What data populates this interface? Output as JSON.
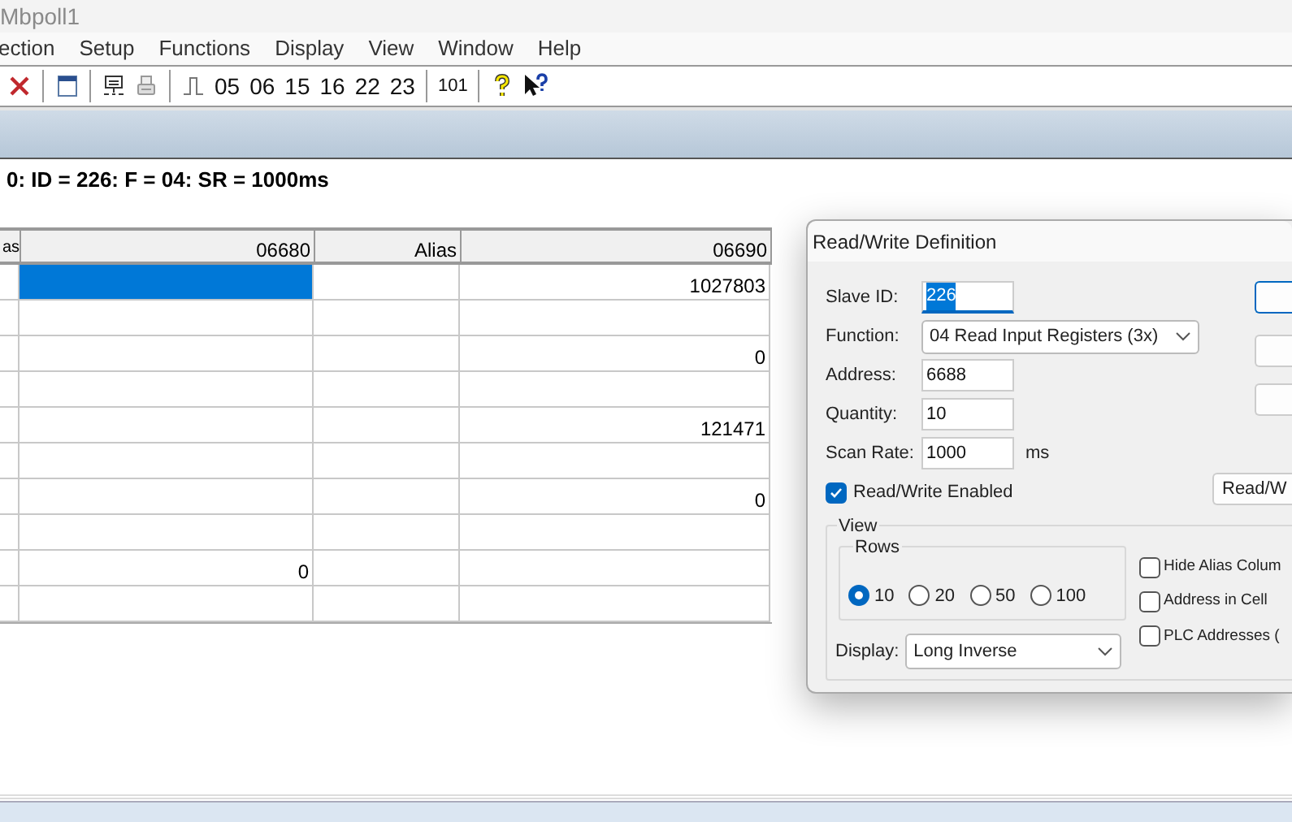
{
  "window": {
    "title": "Mbpoll1"
  },
  "menu": [
    "ection",
    "Setup",
    "Functions",
    "Display",
    "View",
    "Window",
    "Help"
  ],
  "toolbar": [
    {
      "kind": "close"
    },
    {
      "kind": "sep"
    },
    {
      "kind": "window"
    },
    {
      "kind": "sep"
    },
    {
      "kind": "monitor"
    },
    {
      "kind": "printer"
    },
    {
      "kind": "sep"
    },
    {
      "kind": "pulse"
    },
    {
      "kind": "text",
      "label": "05"
    },
    {
      "kind": "text",
      "label": "06"
    },
    {
      "kind": "text",
      "label": "15"
    },
    {
      "kind": "text",
      "label": "16"
    },
    {
      "kind": "text",
      "label": "22"
    },
    {
      "kind": "text",
      "label": "23"
    },
    {
      "kind": "sep"
    },
    {
      "kind": "small",
      "label": "101"
    },
    {
      "kind": "sep"
    },
    {
      "kind": "help"
    },
    {
      "kind": "contexthelp"
    }
  ],
  "status_line": "0: ID = 226: F = 04: SR = 1000ms",
  "table": {
    "columns": [
      "as",
      "06680",
      "Alias",
      "06690"
    ],
    "rows": [
      {
        "selected": true,
        "col_4": "1027803"
      },
      {
        "selected": false
      },
      {
        "selected": false,
        "col_4": "0"
      },
      {
        "selected": false
      },
      {
        "selected": false,
        "col_4": "121471"
      },
      {
        "selected": false
      },
      {
        "selected": false,
        "col_4": "0"
      },
      {
        "selected": false
      },
      {
        "selected": false,
        "col_2": "0"
      },
      {
        "selected": false
      }
    ]
  },
  "dialog": {
    "title": "Read/Write Definition",
    "fields": [
      {
        "kind": "input",
        "label": "Slave ID:",
        "value": "226",
        "focused": true
      },
      {
        "kind": "select",
        "label": "Function:",
        "value": "04 Read Input Registers (3x)"
      },
      {
        "kind": "input",
        "label": "Address:",
        "value": "6688",
        "focused": false
      },
      {
        "kind": "input",
        "label": "Quantity:",
        "value": "10",
        "focused": false
      },
      {
        "kind": "input",
        "label": "Scan Rate:",
        "value": "1000",
        "unit": "ms",
        "focused": false
      }
    ],
    "enabled": {
      "label": "Read/Write Enabled",
      "checked": true
    },
    "side_buttons": [
      {
        "default": true
      },
      {
        "default": false
      },
      {
        "default": false
      }
    ],
    "rw_button": "Read/W",
    "view": {
      "title": "View",
      "rows_title": "Rows",
      "rows": [
        {
          "label": "10",
          "selected": true
        },
        {
          "label": "20",
          "selected": false
        },
        {
          "label": "50",
          "selected": false
        },
        {
          "label": "100",
          "selected": false
        }
      ],
      "display_label": "Display:",
      "display_value": "Long Inverse",
      "options": [
        {
          "label": "Hide Alias Colum",
          "checked": false
        },
        {
          "label": "Address in Cell",
          "checked": false
        },
        {
          "label": "PLC Addresses (",
          "checked": false
        }
      ]
    }
  }
}
